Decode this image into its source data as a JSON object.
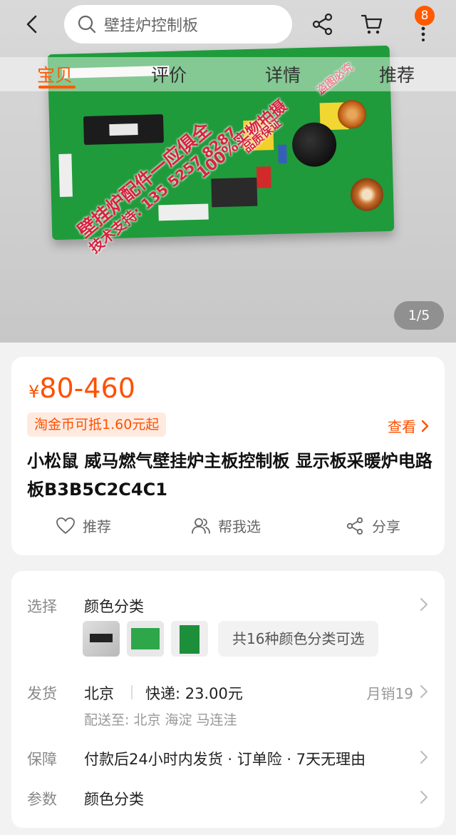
{
  "header": {
    "search_placeholder": "壁挂炉控制板",
    "cart_badge": "8"
  },
  "tabs": [
    "宝贝",
    "评价",
    "详情",
    "推荐"
  ],
  "gallery": {
    "pager": "1/5",
    "watermark_lines": [
      "壁挂炉配件一应俱全",
      "技术支持: 135 5257 8287",
      "100%实物拍摄",
      "品质保证",
      "盗图必究"
    ]
  },
  "product": {
    "currency": "¥",
    "price_range": "80-460",
    "coin_tag": "淘金币可抵1.60元起",
    "view_label": "查看",
    "title": "小松鼠 威马燃气壁挂炉主板控制板 显示板采暖炉电路板B3B5C2C4C1",
    "actions": {
      "recommend": "推荐",
      "help_choose": "帮我选",
      "share": "分享"
    }
  },
  "details": {
    "select": {
      "label": "选择",
      "value": "颜色分类",
      "more_variants": "共16种颜色分类可选"
    },
    "shipping": {
      "label": "发货",
      "from": "北京",
      "fee": "快递: 23.00元",
      "monthly_sales": "月销19",
      "ship_to": "配送至: 北京 海淀 马连洼"
    },
    "guarantee": {
      "label": "保障",
      "value": "付款后24小时内发货 · 订单险 · 7天无理由"
    },
    "params": {
      "label": "参数",
      "value": "颜色分类"
    }
  },
  "colors": {
    "accent": "#ff5000",
    "text_muted": "#888888"
  }
}
